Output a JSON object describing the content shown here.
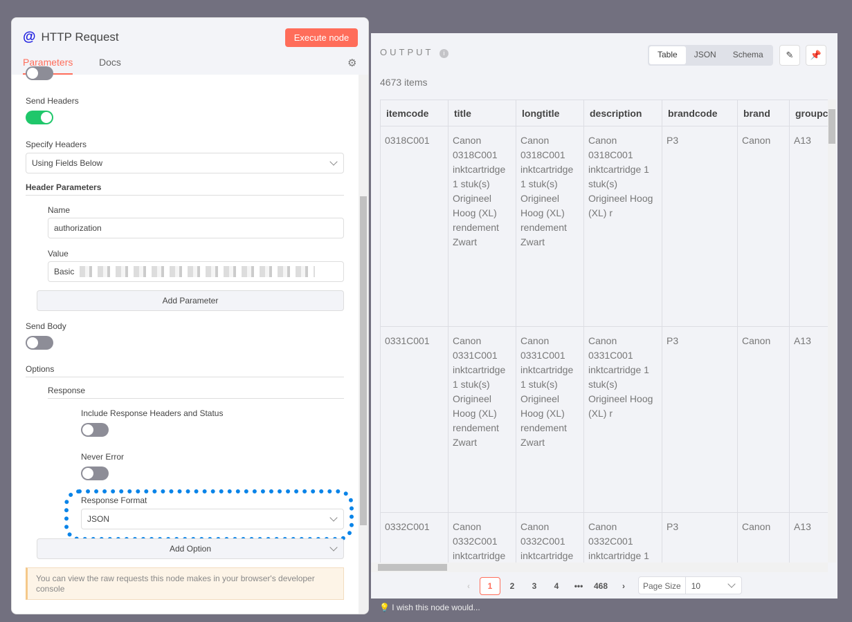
{
  "node": {
    "title": "HTTP Request",
    "execute_label": "Execute node",
    "tabs": [
      "Parameters",
      "Docs"
    ]
  },
  "params": {
    "send_headers_label": "Send Headers",
    "specify_headers_label": "Specify Headers",
    "specify_headers_value": "Using Fields Below",
    "header_params_label": "Header Parameters",
    "name_label": "Name",
    "name_value": "authorization",
    "value_label": "Value",
    "value_value": "Basic",
    "add_parameter": "Add Parameter",
    "send_body_label": "Send Body",
    "options_label": "Options",
    "response_label": "Response",
    "include_headers_label": "Include Response Headers and Status",
    "never_error_label": "Never Error",
    "response_format_label": "Response Format",
    "response_format_value": "JSON",
    "add_option": "Add Option",
    "notice": "You can view the raw requests this node makes in your browser's developer console"
  },
  "output": {
    "title": "OUTPUT",
    "count": "4673 items",
    "views": [
      "Table",
      "JSON",
      "Schema"
    ],
    "columns": [
      "itemcode",
      "title",
      "longtitle",
      "description",
      "brandcode",
      "brand",
      "groupc"
    ],
    "rows": [
      [
        "0318C001",
        "Canon 0318C001 inktcartridge 1 stuk(s) Origineel Hoog (XL) rendement Zwart",
        "Canon 0318C001 inktcartridge 1 stuk(s) Origineel Hoog (XL) rendement Zwart",
        "Canon 0318C001 inktcartridge 1 stuk(s) Origineel Hoog (XL) r",
        "P3",
        "Canon",
        "A13"
      ],
      [
        "0331C001",
        "Canon 0331C001 inktcartridge 1 stuk(s) Origineel Hoog (XL) rendement Zwart",
        "Canon 0331C001 inktcartridge 1 stuk(s) Origineel Hoog (XL) rendement Zwart",
        "Canon 0331C001 inktcartridge 1 stuk(s) Origineel Hoog (XL) r",
        "P3",
        "Canon",
        "A13"
      ],
      [
        "0332C001",
        "Canon 0332C001 inktcartridge",
        "Canon 0332C001 inktcartridge",
        "Canon 0332C001 inktcartridge 1",
        "P3",
        "Canon",
        "A13"
      ]
    ],
    "pages": [
      "1",
      "2",
      "3",
      "4",
      "•••",
      "468"
    ],
    "page_size_label": "Page Size",
    "page_size": "10"
  },
  "feedback": "I wish this node would..."
}
